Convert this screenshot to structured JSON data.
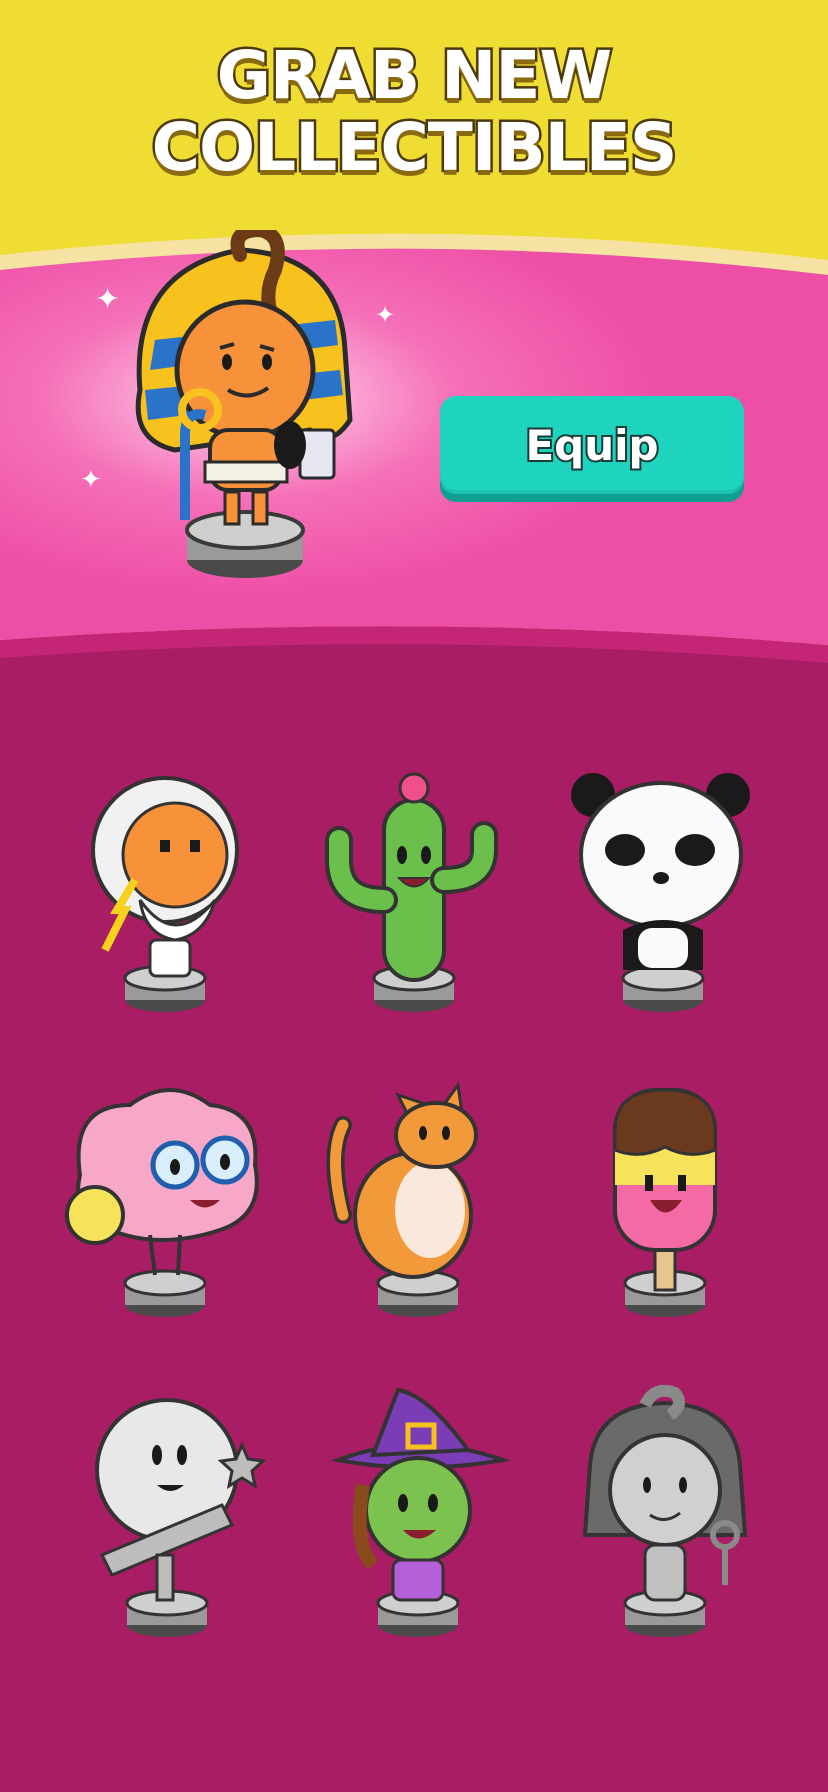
{
  "header": {
    "title_line1": "GRAB NEW",
    "title_line2": "COLLECTIBLES"
  },
  "hero": {
    "character": "pharaoh",
    "equip_label": "Equip"
  },
  "colors": {
    "header_yellow": "#f0dd33",
    "hero_pink": "#ee4fa6",
    "grid_magenta": "#a81d63",
    "equip_teal": "#1fd4bf"
  },
  "collectibles": [
    {
      "name": "zeus",
      "locked": false
    },
    {
      "name": "cactus",
      "locked": false
    },
    {
      "name": "panda",
      "locked": false
    },
    {
      "name": "brain",
      "locked": false
    },
    {
      "name": "cat",
      "locked": false
    },
    {
      "name": "popsicle",
      "locked": false
    },
    {
      "name": "moon-astronomer",
      "locked": false
    },
    {
      "name": "witch",
      "locked": false
    },
    {
      "name": "cleopatra",
      "locked": true
    }
  ]
}
